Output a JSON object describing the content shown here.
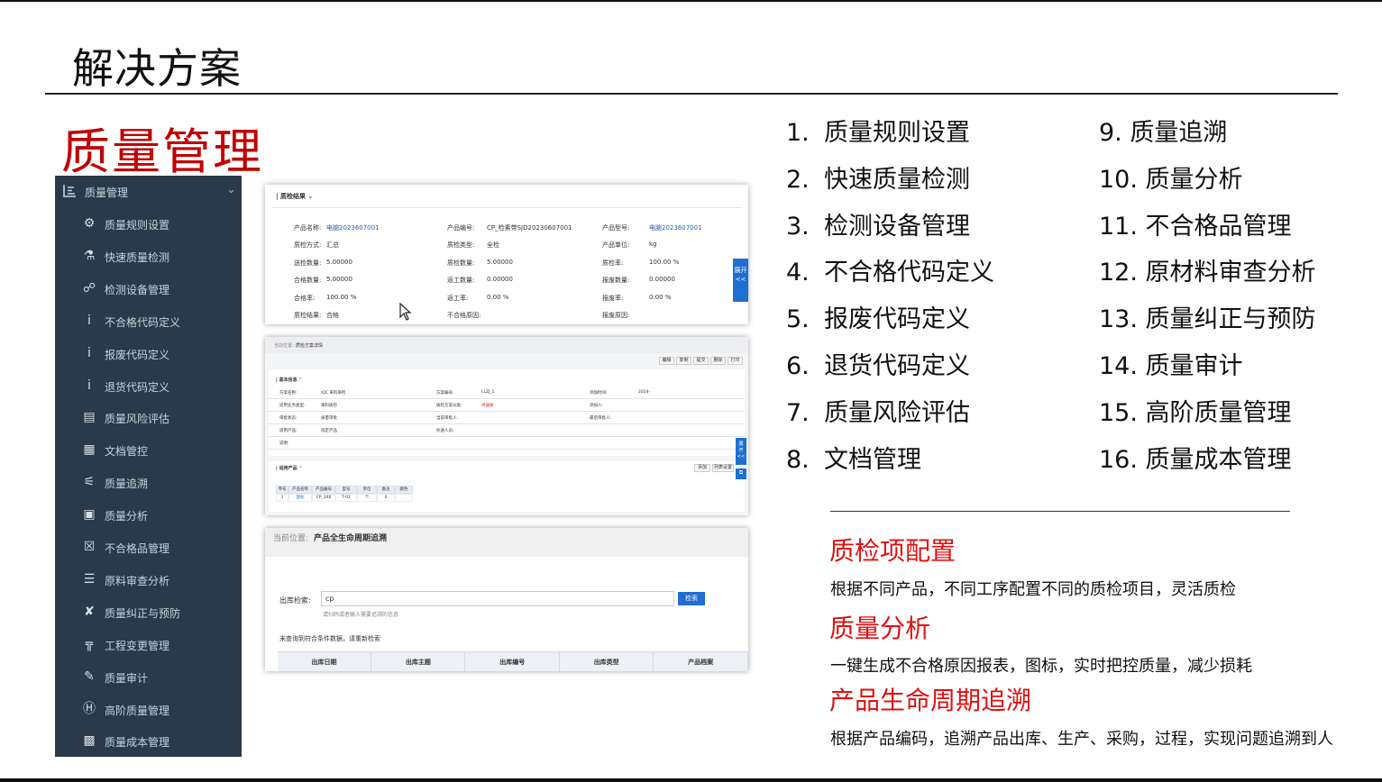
{
  "slide": {
    "title": "解决方案",
    "section_title": "质量管理"
  },
  "sidebar": {
    "header": "质量管理",
    "items": [
      {
        "label": "质量规则设置",
        "icon": "gear-icon"
      },
      {
        "label": "快速质量检测",
        "icon": "flask-icon"
      },
      {
        "label": "检测设备管理",
        "icon": "network-icon"
      },
      {
        "label": "不合格代码定义",
        "icon": "info-icon"
      },
      {
        "label": "报废代码定义",
        "icon": "info-icon"
      },
      {
        "label": "退货代码定义",
        "icon": "info-icon"
      },
      {
        "label": "质量风险评估",
        "icon": "id-card-icon"
      },
      {
        "label": "文档管控",
        "icon": "document-icon"
      },
      {
        "label": "质量追溯",
        "icon": "flow-icon"
      },
      {
        "label": "质量分析",
        "icon": "report-icon"
      },
      {
        "label": "不合格品管理",
        "icon": "close-box-icon"
      },
      {
        "label": "原料审查分析",
        "icon": "checklist-icon"
      },
      {
        "label": "质量纠正与预防",
        "icon": "tools-icon"
      },
      {
        "label": "工程变更管理",
        "icon": "bridge-icon"
      },
      {
        "label": "质量审计",
        "icon": "pen-icon"
      },
      {
        "label": "高阶质量管理",
        "icon": "h-box-icon"
      },
      {
        "label": "质量成本管理",
        "icon": "money-icon"
      }
    ]
  },
  "panel1": {
    "section": "质检结果",
    "rows": [
      [
        {
          "k": "产品名称:",
          "v": "电脑2023607001"
        },
        {
          "k": "产品编号:",
          "v": "CP_检素带SJD20230607001"
        },
        {
          "k": "产品型号:",
          "v": "电脑2023607001"
        }
      ],
      [
        {
          "k": "质检方式:",
          "v": "汇总"
        },
        {
          "k": "质检类型:",
          "v": "全检"
        },
        {
          "k": "产品单位:",
          "v": "kg"
        }
      ],
      [
        {
          "k": "送检数量:",
          "v": "5.00000"
        },
        {
          "k": "质检数量:",
          "v": "5.00000"
        },
        {
          "k": "质检率:",
          "v": "100.00 %"
        }
      ],
      [
        {
          "k": "合格数量:",
          "v": "5.00000"
        },
        {
          "k": "返工数量:",
          "v": "0.00000"
        },
        {
          "k": "报废数量:",
          "v": "0.00000"
        }
      ],
      [
        {
          "k": "合格率:",
          "v": "100.00 %"
        },
        {
          "k": "返工率:",
          "v": "0.00 %"
        },
        {
          "k": "报废率:",
          "v": "0.00 %"
        }
      ],
      [
        {
          "k": "质检结果:",
          "v": "合格"
        },
        {
          "k": "不合格原因:",
          "v": ""
        },
        {
          "k": "报废原因:",
          "v": ""
        }
      ]
    ],
    "side_tab": "展开<<"
  },
  "panel2": {
    "breadcrumb_prefix": "当前位置:",
    "breadcrumb": "质检方案详情",
    "buttons": [
      "编辑",
      "复制",
      "提交",
      "删除",
      "打印"
    ],
    "basic_section": "基本信息",
    "basic_rows": [
      [
        {
          "k": "方案名称:",
          "v": "IQC 来料质检"
        },
        {
          "k": "方案编号:",
          "v": "LLZJ_1"
        },
        {
          "k": "添加时间:",
          "v": "2024-"
        }
      ],
      [
        {
          "k": "适用业务类型:",
          "v": "来料质检"
        },
        {
          "k": "质检方案分类:",
          "v": "待送质"
        },
        {
          "k": "添加人:",
          "v": ""
        }
      ],
      [
        {
          "k": "审批状态:",
          "v": "质量审批"
        },
        {
          "k": "当前审批人:",
          "v": ""
        },
        {
          "k": "最后审批人:",
          "v": ""
        }
      ],
      [
        {
          "k": "适用产品:",
          "v": "指定产品"
        },
        {
          "k": "抄送人员:",
          "v": ""
        },
        {
          "k": "",
          "v": ""
        }
      ],
      [
        {
          "k": "说明:",
          "v": ""
        },
        {
          "k": "",
          "v": ""
        },
        {
          "k": "",
          "v": ""
        }
      ]
    ],
    "product_section": "适用产品",
    "product_buttons": [
      "添加",
      "列表设置"
    ],
    "product_headers": [
      "序号",
      "产品名称",
      "产品编号",
      "型号",
      "单位",
      "备注",
      "颜色"
    ],
    "product_row": [
      "1",
      "鼠标",
      "CP_346",
      "T-01",
      "个",
      "0",
      ""
    ]
  },
  "panel3": {
    "breadcrumb_prefix": "当前位置:",
    "breadcrumb": "产品全生命周期追溯",
    "search_label": "出库检索:",
    "search_value": "cp",
    "search_button": "检索",
    "search_hint": "请扫码或者输入需要追溯的信息",
    "empty_msg": "未查询到符合条件数据，请重新检索",
    "columns": [
      "出库日期",
      "出库主题",
      "出库编号",
      "出库类型",
      "产品档案"
    ]
  },
  "list_left": [
    {
      "num": "1.",
      "label": "质量规则设置"
    },
    {
      "num": "2.",
      "label": "快速质量检测"
    },
    {
      "num": "3.",
      "label": "检测设备管理"
    },
    {
      "num": "4.",
      "label": "不合格代码定义"
    },
    {
      "num": "5.",
      "label": "报废代码定义"
    },
    {
      "num": "6.",
      "label": "退货代码定义"
    },
    {
      "num": "7.",
      "label": "质量风险评估"
    },
    {
      "num": "8.",
      "label": "文档管理"
    }
  ],
  "list_right": [
    "9. 质量追溯",
    "10. 质量分析",
    "11. 不合格品管理",
    "12. 原材料审查分析",
    "13. 质量纠正与预防",
    "14. 质量审计",
    "15. 高阶质量管理",
    "16. 质量成本管理"
  ],
  "features": [
    {
      "title": "质检项配置",
      "desc": "根据不同产品，不同工序配置不同的质检项目，灵活质检"
    },
    {
      "title": "质量分析",
      "desc": "一键生成不合格原因报表，图标，实时把控质量，减少损耗"
    },
    {
      "title": "产品生命周期追溯",
      "desc": "根据产品编码，追溯产品出库、生产、采购，过程，实现问题追溯到人"
    }
  ],
  "colors": {
    "title_red": "#c00000",
    "feature_red": "#e01010",
    "sidebar_bg": "#2b3a4a",
    "accent_blue": "#1f6fd0"
  }
}
